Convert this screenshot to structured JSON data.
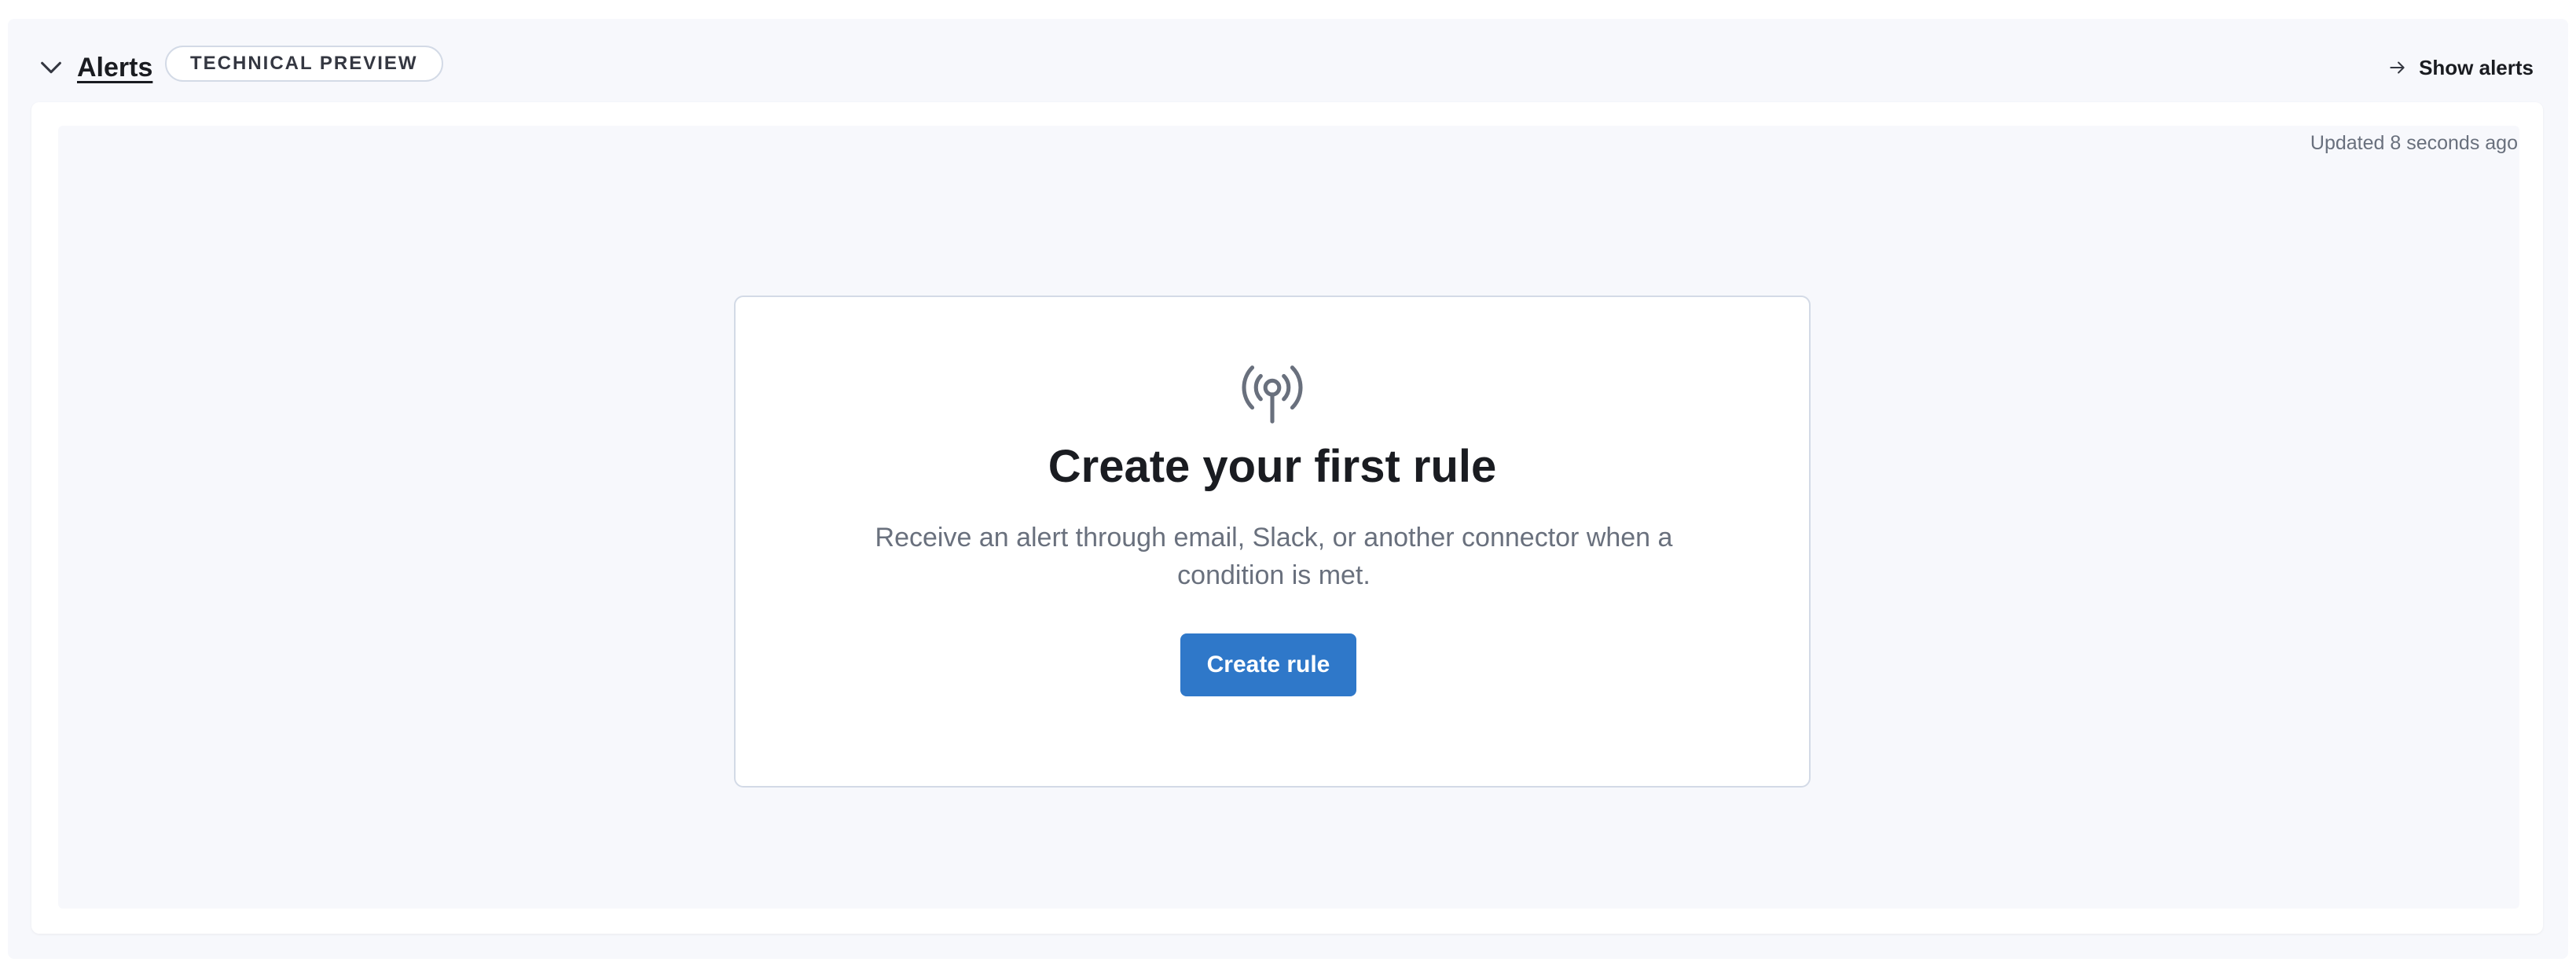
{
  "header": {
    "collapse_icon": "chevron-down-icon",
    "title": "Alerts",
    "badge": "TECHNICAL PREVIEW",
    "show_alerts_icon": "arrow-right-icon",
    "show_alerts_label": "Show alerts"
  },
  "status": {
    "updated_text": "Updated 8 seconds ago"
  },
  "empty_prompt": {
    "icon": "broadcast-antenna-icon",
    "title": "Create your first rule",
    "body": "Receive an alert through email, Slack, or another connector when a condition is met.",
    "button_label": "Create rule"
  },
  "colors": {
    "accent": "#2f78c9",
    "panel_bg": "#f7f8fc",
    "border": "#d3dae6",
    "subdued_text": "#69707d"
  }
}
